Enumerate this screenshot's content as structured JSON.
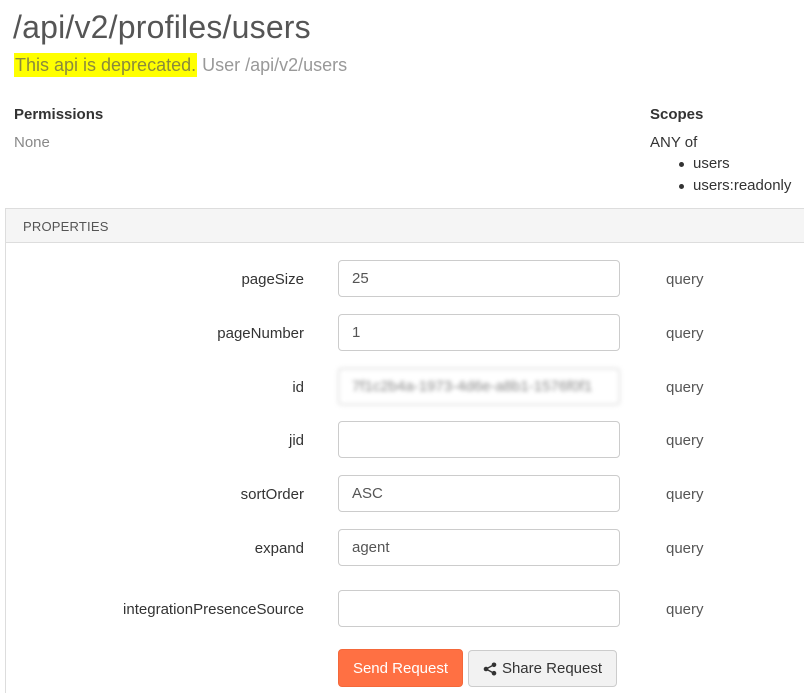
{
  "page": {
    "title": "/api/v2/profiles/users",
    "deprecated_text": "This api is deprecated.",
    "deprecated_suggestion": "User /api/v2/users"
  },
  "permissions": {
    "label": "Permissions",
    "value": "None"
  },
  "scopes": {
    "label": "Scopes",
    "mode": "ANY of",
    "items": [
      "users",
      "users:readonly"
    ]
  },
  "properties": {
    "header": "PROPERTIES",
    "fields": [
      {
        "name": "pageSize",
        "value": "25",
        "location": "query"
      },
      {
        "name": "pageNumber",
        "value": "1",
        "location": "query"
      },
      {
        "name": "id",
        "value": "7f1c2b4a-1973-4d6e-a8b1-1576f0f1",
        "location": "query",
        "obscured": true
      },
      {
        "name": "jid",
        "value": "",
        "location": "query"
      },
      {
        "name": "sortOrder",
        "value": "ASC",
        "location": "query"
      },
      {
        "name": "expand",
        "value": "agent",
        "location": "query"
      },
      {
        "name": "integrationPresenceSource",
        "value": "",
        "location": "query"
      }
    ]
  },
  "actions": {
    "send_label": "Send Request",
    "share_label": "Share Request",
    "share_icon": "share-icon"
  },
  "colors": {
    "highlight": "#ffff00",
    "send_button": "#ff7043"
  }
}
